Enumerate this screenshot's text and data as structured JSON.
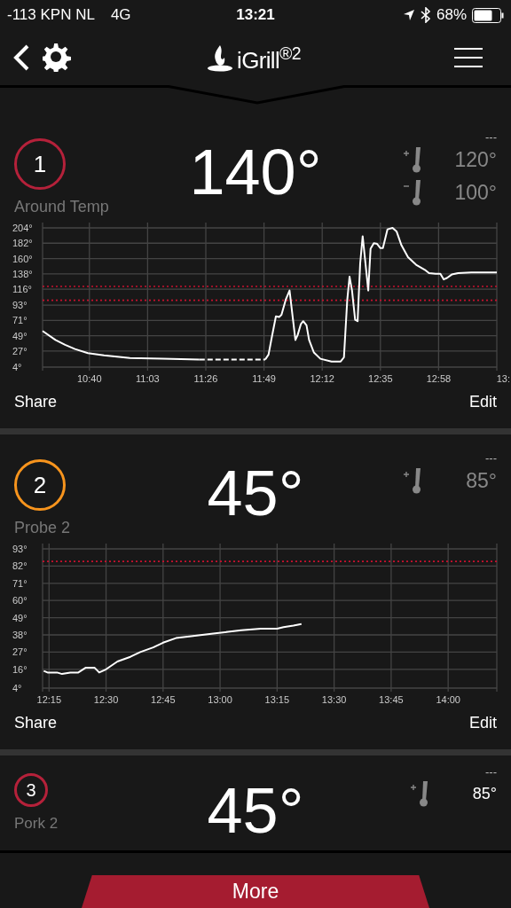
{
  "status_bar": {
    "carrier": "-113 KPN NL",
    "network": "4G",
    "time": "13:21",
    "battery": "68%"
  },
  "header": {
    "logo": "iGrill$^{®2}$"
  },
  "probes": [
    {
      "kind": "full",
      "number": "1",
      "color": "#b5213a",
      "temperature": "140°",
      "name": "Around Temp",
      "range_label": "---",
      "targets": [
        {
          "kind": "max",
          "value": "120°"
        },
        {
          "kind": "min",
          "value": "100°"
        }
      ],
      "chart_data": {
        "type": "line",
        "grid": true,
        "xlim": [
          621.5,
          801
        ],
        "ylim": [
          4,
          204
        ],
        "yticks": [
          {
            "value": 4,
            "label": "4°"
          },
          {
            "value": 27,
            "label": "27°"
          },
          {
            "value": 49,
            "label": "49°"
          },
          {
            "value": 71,
            "label": "71°"
          },
          {
            "value": 93,
            "label": "93°"
          },
          {
            "value": 116,
            "label": "116°"
          },
          {
            "value": 138,
            "label": "138°"
          },
          {
            "value": 160,
            "label": "160°"
          },
          {
            "value": 182,
            "label": "182°"
          },
          {
            "value": 204,
            "label": "204°"
          }
        ],
        "xticks": [
          {
            "value": 640,
            "label": "10:40"
          },
          {
            "value": 663,
            "label": "11:03"
          },
          {
            "value": 686,
            "label": "11:26"
          },
          {
            "value": 709,
            "label": "11:49"
          },
          {
            "value": 732,
            "label": "12:12"
          },
          {
            "value": 755,
            "label": "12:35"
          },
          {
            "value": 778,
            "label": "12:58"
          }
        ],
        "x": [
          621.5,
          626.6,
          630.4,
          634.3,
          639.4,
          645.8,
          656,
          668.8,
          683.5,
          696.5,
          709.5,
          710.8,
          712,
          713.7,
          715,
          715.9,
          717.6,
          719.1,
          720.4,
          721.4,
          722.3,
          723.6,
          724.5,
          725.8,
          726.8,
          728.7,
          731.3,
          735.7,
          739.3,
          740.6,
          741.9,
          742.8,
          743.8,
          745,
          746,
          747,
          748,
          749.2,
          750.2,
          751.1,
          752.4,
          753.7,
          755,
          756,
          757.8,
          759.8,
          761.4,
          763.3,
          765.9,
          769.1,
          772.9,
          774.2,
          776.8,
          778.7,
          780,
          781.3,
          783.2,
          785.7,
          790.9,
          797.9,
          801
        ],
        "series": [
          {
            "values": [
              56,
              43,
              36,
              30,
              24,
              21,
              17,
              16,
              15,
              null,
              15,
              22,
              45,
              77,
              76,
              79,
              101,
              114,
              74,
              43,
              50,
              66,
              70,
              64,
              43,
              25,
              16,
              12,
              12,
              18,
              100,
              134,
              114,
              72,
              70,
              153,
              192,
              150,
              114,
              174,
              182,
              181,
              175,
              175,
              202,
              204,
              199,
              179,
              162,
              151,
              143,
              139,
              138,
              138,
              130,
              132,
              137,
              139,
              140,
              140,
              140
            ]
          }
        ],
        "ref_lines": [
          {
            "axis": "y",
            "value": 120,
            "color": "#c8102e"
          },
          {
            "axis": "y",
            "value": 100,
            "color": "#c8102e"
          }
        ]
      },
      "chart_edge_label": "13:",
      "actions": [
        "Share",
        "Edit"
      ]
    },
    {
      "kind": "full",
      "number": "2",
      "color": "#f7941d",
      "temperature": "45°",
      "name": "Probe 2",
      "range_label": "---",
      "targets": [
        {
          "kind": "max",
          "value": "85°"
        }
      ],
      "chart_data": {
        "type": "line",
        "grid": true,
        "xlim": [
          733.3,
          852.8
        ],
        "ylim": [
          4,
          93
        ],
        "yticks": [
          {
            "value": 4,
            "label": "4°"
          },
          {
            "value": 16,
            "label": "16°"
          },
          {
            "value": 27,
            "label": "27°"
          },
          {
            "value": 38,
            "label": "38°"
          },
          {
            "value": 49,
            "label": "49°"
          },
          {
            "value": 60,
            "label": "60°"
          },
          {
            "value": 71,
            "label": "71°"
          },
          {
            "value": 82,
            "label": "82°"
          },
          {
            "value": 93,
            "label": "93°"
          }
        ],
        "xticks": [
          {
            "value": 735,
            "label": "12:15"
          },
          {
            "value": 750,
            "label": "12:30"
          },
          {
            "value": 765,
            "label": "12:45"
          },
          {
            "value": 780,
            "label": "13:00"
          },
          {
            "value": 795,
            "label": "13:15"
          },
          {
            "value": 810,
            "label": "13:30"
          },
          {
            "value": 825,
            "label": "13:45"
          },
          {
            "value": 840,
            "label": "14:00"
          }
        ],
        "x": [
          733.6,
          734.6,
          737.1,
          738.4,
          740.6,
          742.7,
          744.6,
          747,
          748.2,
          750,
          753,
          756.4,
          759,
          762.4,
          765,
          768.4,
          771.9,
          775.3,
          778.7,
          782.1,
          785.6,
          790.7,
          795,
          796.7,
          799.3,
          801.4
        ],
        "series": [
          {
            "values": [
              15,
              14,
              14,
              13,
              14,
              14,
              17,
              17,
              14,
              16,
              21,
              24,
              27,
              30,
              33,
              36,
              37,
              38,
              39,
              40,
              41,
              42,
              42,
              43,
              44,
              45
            ]
          }
        ],
        "ref_lines": [
          {
            "axis": "y",
            "value": 85,
            "color": "#c8102e"
          }
        ]
      },
      "actions": [
        "Share",
        "Edit"
      ]
    },
    {
      "kind": "compact",
      "number": "3",
      "color": "#b5213a",
      "temperature": "45°",
      "name": "Pork 2",
      "range_label": "---",
      "targets": [
        {
          "kind": "max",
          "value": "85°"
        }
      ]
    }
  ],
  "more_button": "More"
}
